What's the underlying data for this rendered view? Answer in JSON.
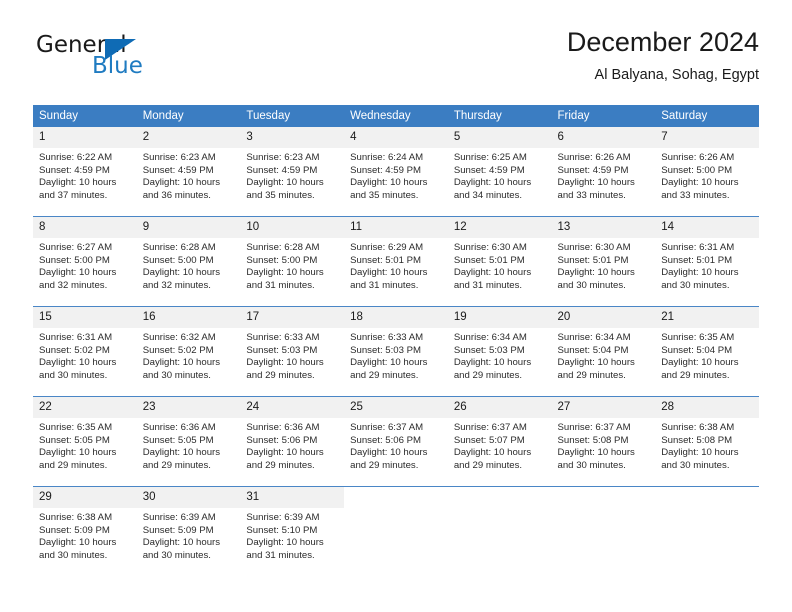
{
  "logo": {
    "word_top": "General",
    "word_bottom": "Blue",
    "accent_color": "#0f6bb5"
  },
  "header": {
    "title": "December 2024",
    "subtitle": "Al Balyana, Sohag, Egypt"
  },
  "theme": {
    "header_blue": "#3b7dc2",
    "row_divider": "#4a86c6",
    "daynum_band": "#f1f1f1"
  },
  "calendar": {
    "weekday_headers": [
      "Sunday",
      "Monday",
      "Tuesday",
      "Wednesday",
      "Thursday",
      "Friday",
      "Saturday"
    ],
    "weeks": [
      [
        {
          "day": "1",
          "sunrise": "Sunrise: 6:22 AM",
          "sunset": "Sunset: 4:59 PM",
          "daylight1": "Daylight: 10 hours",
          "daylight2": "and 37 minutes."
        },
        {
          "day": "2",
          "sunrise": "Sunrise: 6:23 AM",
          "sunset": "Sunset: 4:59 PM",
          "daylight1": "Daylight: 10 hours",
          "daylight2": "and 36 minutes."
        },
        {
          "day": "3",
          "sunrise": "Sunrise: 6:23 AM",
          "sunset": "Sunset: 4:59 PM",
          "daylight1": "Daylight: 10 hours",
          "daylight2": "and 35 minutes."
        },
        {
          "day": "4",
          "sunrise": "Sunrise: 6:24 AM",
          "sunset": "Sunset: 4:59 PM",
          "daylight1": "Daylight: 10 hours",
          "daylight2": "and 35 minutes."
        },
        {
          "day": "5",
          "sunrise": "Sunrise: 6:25 AM",
          "sunset": "Sunset: 4:59 PM",
          "daylight1": "Daylight: 10 hours",
          "daylight2": "and 34 minutes."
        },
        {
          "day": "6",
          "sunrise": "Sunrise: 6:26 AM",
          "sunset": "Sunset: 4:59 PM",
          "daylight1": "Daylight: 10 hours",
          "daylight2": "and 33 minutes."
        },
        {
          "day": "7",
          "sunrise": "Sunrise: 6:26 AM",
          "sunset": "Sunset: 5:00 PM",
          "daylight1": "Daylight: 10 hours",
          "daylight2": "and 33 minutes."
        }
      ],
      [
        {
          "day": "8",
          "sunrise": "Sunrise: 6:27 AM",
          "sunset": "Sunset: 5:00 PM",
          "daylight1": "Daylight: 10 hours",
          "daylight2": "and 32 minutes."
        },
        {
          "day": "9",
          "sunrise": "Sunrise: 6:28 AM",
          "sunset": "Sunset: 5:00 PM",
          "daylight1": "Daylight: 10 hours",
          "daylight2": "and 32 minutes."
        },
        {
          "day": "10",
          "sunrise": "Sunrise: 6:28 AM",
          "sunset": "Sunset: 5:00 PM",
          "daylight1": "Daylight: 10 hours",
          "daylight2": "and 31 minutes."
        },
        {
          "day": "11",
          "sunrise": "Sunrise: 6:29 AM",
          "sunset": "Sunset: 5:01 PM",
          "daylight1": "Daylight: 10 hours",
          "daylight2": "and 31 minutes."
        },
        {
          "day": "12",
          "sunrise": "Sunrise: 6:30 AM",
          "sunset": "Sunset: 5:01 PM",
          "daylight1": "Daylight: 10 hours",
          "daylight2": "and 31 minutes."
        },
        {
          "day": "13",
          "sunrise": "Sunrise: 6:30 AM",
          "sunset": "Sunset: 5:01 PM",
          "daylight1": "Daylight: 10 hours",
          "daylight2": "and 30 minutes."
        },
        {
          "day": "14",
          "sunrise": "Sunrise: 6:31 AM",
          "sunset": "Sunset: 5:01 PM",
          "daylight1": "Daylight: 10 hours",
          "daylight2": "and 30 minutes."
        }
      ],
      [
        {
          "day": "15",
          "sunrise": "Sunrise: 6:31 AM",
          "sunset": "Sunset: 5:02 PM",
          "daylight1": "Daylight: 10 hours",
          "daylight2": "and 30 minutes."
        },
        {
          "day": "16",
          "sunrise": "Sunrise: 6:32 AM",
          "sunset": "Sunset: 5:02 PM",
          "daylight1": "Daylight: 10 hours",
          "daylight2": "and 30 minutes."
        },
        {
          "day": "17",
          "sunrise": "Sunrise: 6:33 AM",
          "sunset": "Sunset: 5:03 PM",
          "daylight1": "Daylight: 10 hours",
          "daylight2": "and 29 minutes."
        },
        {
          "day": "18",
          "sunrise": "Sunrise: 6:33 AM",
          "sunset": "Sunset: 5:03 PM",
          "daylight1": "Daylight: 10 hours",
          "daylight2": "and 29 minutes."
        },
        {
          "day": "19",
          "sunrise": "Sunrise: 6:34 AM",
          "sunset": "Sunset: 5:03 PM",
          "daylight1": "Daylight: 10 hours",
          "daylight2": "and 29 minutes."
        },
        {
          "day": "20",
          "sunrise": "Sunrise: 6:34 AM",
          "sunset": "Sunset: 5:04 PM",
          "daylight1": "Daylight: 10 hours",
          "daylight2": "and 29 minutes."
        },
        {
          "day": "21",
          "sunrise": "Sunrise: 6:35 AM",
          "sunset": "Sunset: 5:04 PM",
          "daylight1": "Daylight: 10 hours",
          "daylight2": "and 29 minutes."
        }
      ],
      [
        {
          "day": "22",
          "sunrise": "Sunrise: 6:35 AM",
          "sunset": "Sunset: 5:05 PM",
          "daylight1": "Daylight: 10 hours",
          "daylight2": "and 29 minutes."
        },
        {
          "day": "23",
          "sunrise": "Sunrise: 6:36 AM",
          "sunset": "Sunset: 5:05 PM",
          "daylight1": "Daylight: 10 hours",
          "daylight2": "and 29 minutes."
        },
        {
          "day": "24",
          "sunrise": "Sunrise: 6:36 AM",
          "sunset": "Sunset: 5:06 PM",
          "daylight1": "Daylight: 10 hours",
          "daylight2": "and 29 minutes."
        },
        {
          "day": "25",
          "sunrise": "Sunrise: 6:37 AM",
          "sunset": "Sunset: 5:06 PM",
          "daylight1": "Daylight: 10 hours",
          "daylight2": "and 29 minutes."
        },
        {
          "day": "26",
          "sunrise": "Sunrise: 6:37 AM",
          "sunset": "Sunset: 5:07 PM",
          "daylight1": "Daylight: 10 hours",
          "daylight2": "and 29 minutes."
        },
        {
          "day": "27",
          "sunrise": "Sunrise: 6:37 AM",
          "sunset": "Sunset: 5:08 PM",
          "daylight1": "Daylight: 10 hours",
          "daylight2": "and 30 minutes."
        },
        {
          "day": "28",
          "sunrise": "Sunrise: 6:38 AM",
          "sunset": "Sunset: 5:08 PM",
          "daylight1": "Daylight: 10 hours",
          "daylight2": "and 30 minutes."
        }
      ],
      [
        {
          "day": "29",
          "sunrise": "Sunrise: 6:38 AM",
          "sunset": "Sunset: 5:09 PM",
          "daylight1": "Daylight: 10 hours",
          "daylight2": "and 30 minutes."
        },
        {
          "day": "30",
          "sunrise": "Sunrise: 6:39 AM",
          "sunset": "Sunset: 5:09 PM",
          "daylight1": "Daylight: 10 hours",
          "daylight2": "and 30 minutes."
        },
        {
          "day": "31",
          "sunrise": "Sunrise: 6:39 AM",
          "sunset": "Sunset: 5:10 PM",
          "daylight1": "Daylight: 10 hours",
          "daylight2": "and 31 minutes."
        },
        {
          "day": "",
          "sunrise": "",
          "sunset": "",
          "daylight1": "",
          "daylight2": ""
        },
        {
          "day": "",
          "sunrise": "",
          "sunset": "",
          "daylight1": "",
          "daylight2": ""
        },
        {
          "day": "",
          "sunrise": "",
          "sunset": "",
          "daylight1": "",
          "daylight2": ""
        },
        {
          "day": "",
          "sunrise": "",
          "sunset": "",
          "daylight1": "",
          "daylight2": ""
        }
      ]
    ]
  }
}
